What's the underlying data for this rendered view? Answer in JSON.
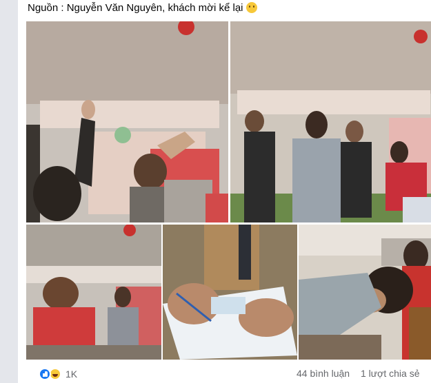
{
  "post": {
    "caption": "Nguồn : Nguyễn Văn Nguyên, khách mời kể lại",
    "caption_emoji": "crying-face-emoji"
  },
  "photos": [
    {
      "name": "photo-tent-dance-1"
    },
    {
      "name": "photo-tent-dance-2"
    },
    {
      "name": "photo-tent-dance-3"
    },
    {
      "name": "photo-writing-paper"
    },
    {
      "name": "photo-man-leaning"
    }
  ],
  "stats": {
    "reaction_count": "1K",
    "comments": "44 bình luận",
    "shares": "1 lượt chia sẻ",
    "reaction_icons": [
      "like-icon",
      "haha-icon"
    ]
  },
  "colors": {
    "like": "#1877f2",
    "haha": "#f7c83a",
    "muted_text": "#65676b",
    "background": "#f0f2f5"
  }
}
